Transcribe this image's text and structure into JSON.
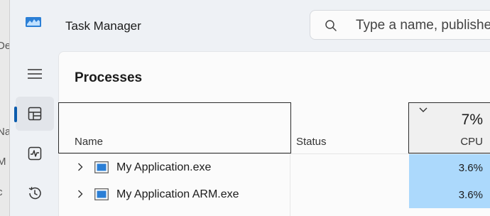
{
  "background_window": {
    "fragments": [
      "De",
      "Na",
      "M",
      "c"
    ]
  },
  "window": {
    "title": "Task Manager"
  },
  "search": {
    "placeholder": "Type a name, publisher, or PID to search"
  },
  "nav": {
    "items": [
      {
        "icon": "hamburger-menu-icon"
      },
      {
        "icon": "processes-icon",
        "active": true
      },
      {
        "icon": "performance-icon"
      },
      {
        "icon": "app-history-icon"
      }
    ]
  },
  "page": {
    "title": "Processes"
  },
  "table": {
    "columns": {
      "name": "Name",
      "status": "Status",
      "cpu_label": "CPU",
      "cpu_total": "7%"
    },
    "rows": [
      {
        "name": "My Application.exe",
        "status": "",
        "cpu": "3.6%"
      },
      {
        "name": "My Application ARM.exe",
        "status": "",
        "cpu": "3.6%"
      }
    ]
  },
  "colors": {
    "accent": "#0b5cad",
    "cpu_highlight": "#acd9fc"
  }
}
